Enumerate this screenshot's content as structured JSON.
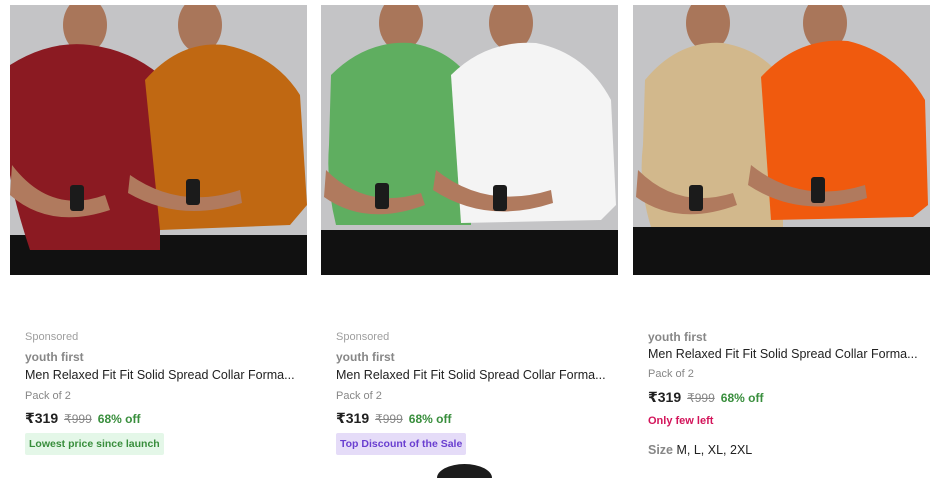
{
  "products": [
    {
      "sponsored": "Sponsored",
      "brand": "youth first",
      "title": "Men Relaxed Fit Fit Solid Spread Collar Forma...",
      "pack": "Pack of 2",
      "price": "₹319",
      "mrp": "₹999",
      "discount": "68% off",
      "tag": "Lowest price since launch",
      "shirt_colors": [
        "#8b1a22",
        "#c06812"
      ]
    },
    {
      "sponsored": "Sponsored",
      "brand": "youth first",
      "title": "Men Relaxed Fit Fit Solid Spread Collar Forma...",
      "pack": "Pack of 2",
      "price": "₹319",
      "mrp": "₹999",
      "discount": "68% off",
      "tag": "Top Discount of the Sale",
      "shirt_colors": [
        "#5fae60",
        "#f4f4f4"
      ]
    },
    {
      "brand": "youth first",
      "title": "Men Relaxed Fit Fit Solid Spread Collar Forma...",
      "pack": "Pack of 2",
      "price": "₹319",
      "mrp": "₹999",
      "discount": "68% off",
      "stock_note": "Only few left",
      "size_label": "Size",
      "sizes": "M, L, XL, 2XL",
      "shirt_colors": [
        "#d2b88c",
        "#f05a0e"
      ]
    }
  ],
  "colors": {
    "discount_green": "#388e3c",
    "tag_green_bg": "#e4f7e8",
    "tag_purple_bg": "#e5dcf8",
    "tag_purple_text": "#6a3fd0",
    "stock_red": "#d3145a",
    "image_bg": "#c4c4c6"
  }
}
